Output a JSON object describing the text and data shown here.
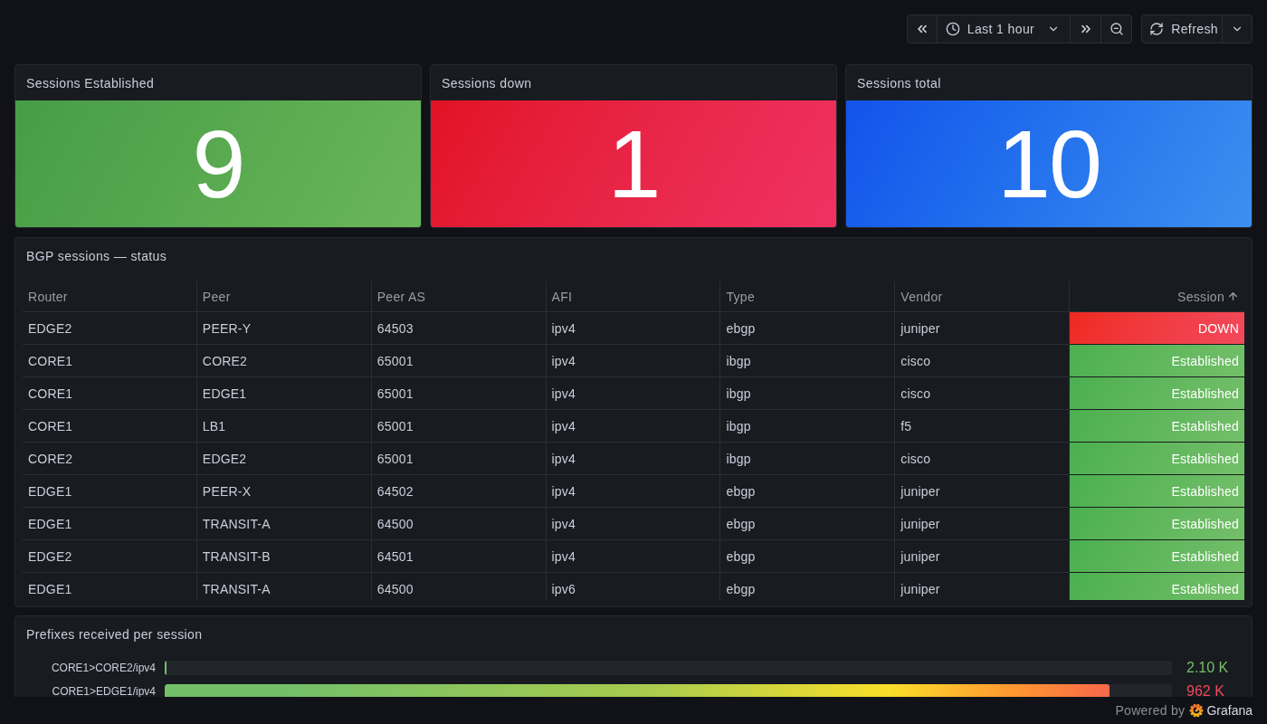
{
  "toolbar": {
    "time_range": "Last 1 hour",
    "refresh": "Refresh"
  },
  "stats": [
    {
      "title": "Sessions Established",
      "value": "9",
      "color": "#6ab65a"
    },
    {
      "title": "Sessions down",
      "value": "1",
      "color": "#ef3262"
    },
    {
      "title": "Sessions total",
      "value": "10",
      "color": "#3d8fef"
    }
  ],
  "table": {
    "title": "BGP sessions — status",
    "columns": [
      {
        "label": "Router",
        "kind": "text",
        "sorted": false
      },
      {
        "label": "Peer",
        "kind": "text",
        "sorted": false
      },
      {
        "label": "Peer AS",
        "kind": "text",
        "sorted": false
      },
      {
        "label": "AFI",
        "kind": "text",
        "sorted": false
      },
      {
        "label": "Type",
        "kind": "text",
        "sorted": false
      },
      {
        "label": "Vendor",
        "kind": "text",
        "sorted": false
      },
      {
        "label": "Session",
        "kind": "status",
        "sorted": true
      }
    ],
    "rows": [
      {
        "cells": [
          "EDGE2",
          "PEER-Y",
          "64503",
          "ipv4",
          "ebgp",
          "juniper",
          "DOWN"
        ],
        "color": "#f2495c"
      },
      {
        "cells": [
          "CORE1",
          "CORE2",
          "65001",
          "ipv4",
          "ibgp",
          "cisco",
          "Established"
        ],
        "color": "#73bf69"
      },
      {
        "cells": [
          "CORE1",
          "EDGE1",
          "65001",
          "ipv4",
          "ibgp",
          "cisco",
          "Established"
        ],
        "color": "#73bf69"
      },
      {
        "cells": [
          "CORE1",
          "LB1",
          "65001",
          "ipv4",
          "ibgp",
          "f5",
          "Established"
        ],
        "color": "#73bf69"
      },
      {
        "cells": [
          "CORE2",
          "EDGE2",
          "65001",
          "ipv4",
          "ibgp",
          "cisco",
          "Established"
        ],
        "color": "#73bf69"
      },
      {
        "cells": [
          "EDGE1",
          "PEER-X",
          "64502",
          "ipv4",
          "ebgp",
          "juniper",
          "Established"
        ],
        "color": "#73bf69"
      },
      {
        "cells": [
          "EDGE1",
          "TRANSIT-A",
          "64500",
          "ipv4",
          "ebgp",
          "juniper",
          "Established"
        ],
        "color": "#73bf69"
      },
      {
        "cells": [
          "EDGE2",
          "TRANSIT-B",
          "64501",
          "ipv4",
          "ebgp",
          "juniper",
          "Established"
        ],
        "color": "#73bf69"
      },
      {
        "cells": [
          "EDGE1",
          "TRANSIT-A",
          "64500",
          "ipv6",
          "ebgp",
          "juniper",
          "Established"
        ],
        "color": "#73bf69"
      }
    ]
  },
  "bar_gauge": {
    "title": "Prefixes received per session",
    "items": [
      {
        "label": "CORE1>CORE2/ipv4",
        "value": "2.10 K",
        "level": 0.002,
        "color": "#73bf69"
      },
      {
        "label": "CORE1>EDGE1/ipv4",
        "value": "962 K",
        "level": 0.938,
        "color": "#f2495c"
      }
    ]
  },
  "footer": {
    "text": "Powered by",
    "brand": "Grafana"
  }
}
